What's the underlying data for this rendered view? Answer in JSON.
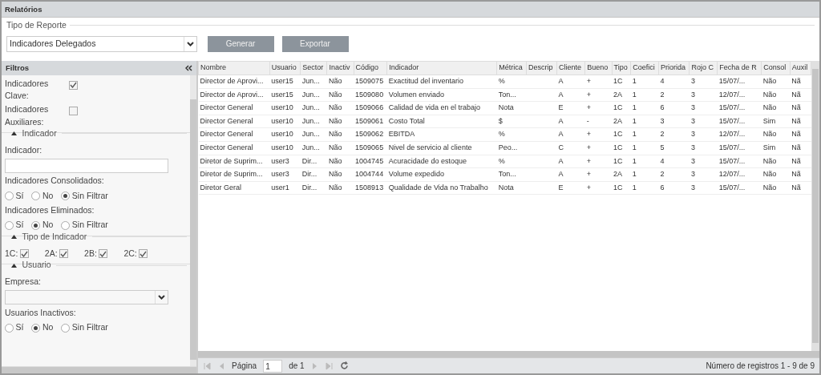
{
  "window": {
    "title": "Relatórios"
  },
  "report": {
    "legend": "Tipo de Reporte",
    "select_value": "Indicadores Delegados",
    "buttons": [
      "Generar",
      "Exportar"
    ]
  },
  "filters": {
    "title": "Filtros",
    "checks": [
      {
        "label": "Indicadores Clave:",
        "checked": true
      },
      {
        "label": "Indicadores Auxiliares:",
        "checked": false
      }
    ],
    "sections": [
      {
        "kind": "indicador",
        "legend": "Indicador",
        "expanded": true,
        "field_label": "Indicador:",
        "radio_groups": [
          {
            "label": "Indicadores Consolidados:",
            "options": [
              {
                "label": "Sí",
                "selected": false
              },
              {
                "label": "No",
                "selected": false
              },
              {
                "label": "Sin Filtrar",
                "selected": true
              }
            ]
          },
          {
            "label": "Indicadores Eliminados:",
            "options": [
              {
                "label": "Sí",
                "selected": false
              },
              {
                "label": "No",
                "selected": true
              },
              {
                "label": "Sin Filtrar",
                "selected": false
              }
            ]
          }
        ]
      },
      {
        "kind": "tipo",
        "legend": "Tipo de Indicador",
        "expanded": true,
        "types": [
          {
            "label": "1C:",
            "checked": true
          },
          {
            "label": "2A:",
            "checked": true
          },
          {
            "label": "2B:",
            "checked": true
          },
          {
            "label": "2C:",
            "checked": true
          }
        ]
      },
      {
        "kind": "usuario",
        "legend": "Usuario",
        "expanded": true,
        "field_label": "Empresa:",
        "radio_groups": [
          {
            "label": "Usuarios Inactivos:",
            "options": [
              {
                "label": "Sí",
                "selected": false
              },
              {
                "label": "No",
                "selected": true
              },
              {
                "label": "Sin Filtrar",
                "selected": false
              }
            ]
          }
        ]
      }
    ]
  },
  "table": {
    "columns": [
      "Nombre",
      "Usuario",
      "Sector",
      "Inactiv",
      "Código",
      "Indicador",
      "Métrica",
      "Descrip",
      "Cliente",
      "Bueno",
      "Tipo",
      "Coefici",
      "Priorida",
      "Rojo C",
      "Fecha de R",
      "Consol",
      "Auxil"
    ],
    "rows": [
      [
        "Director de Aprovi...",
        "user15",
        "Jun...",
        "Não",
        "1509075",
        "Exactitud del inventario",
        "%",
        "",
        "A",
        "+",
        "1C",
        "1",
        "4",
        "3",
        "15/07/...",
        "Não",
        "Nã"
      ],
      [
        "Director de Aprovi...",
        "user15",
        "Jun...",
        "Não",
        "1509080",
        "Volumen enviado",
        "Ton...",
        "",
        "A",
        "+",
        "2A",
        "1",
        "2",
        "3",
        "12/07/...",
        "Não",
        "Nã"
      ],
      [
        "Director General",
        "user10",
        "Jun...",
        "Não",
        "1509066",
        "Calidad de vida en el trabajo",
        "Nota",
        "",
        "E",
        "+",
        "1C",
        "1",
        "6",
        "3",
        "15/07/...",
        "Não",
        "Nã"
      ],
      [
        "Director General",
        "user10",
        "Jun...",
        "Não",
        "1509061",
        "Costo Total",
        "$",
        "",
        "A",
        "-",
        "2A",
        "1",
        "3",
        "3",
        "15/07/...",
        "Sim",
        "Nã"
      ],
      [
        "Director General",
        "user10",
        "Jun...",
        "Não",
        "1509062",
        "EBITDA",
        "%",
        "",
        "A",
        "+",
        "1C",
        "1",
        "2",
        "3",
        "12/07/...",
        "Não",
        "Nã"
      ],
      [
        "Director General",
        "user10",
        "Jun...",
        "Não",
        "1509065",
        "Nivel de servicio al cliente",
        "Peo...",
        "",
        "C",
        "+",
        "1C",
        "1",
        "5",
        "3",
        "15/07/...",
        "Sim",
        "Nã"
      ],
      [
        "Diretor de Suprim...",
        "user3",
        "Dir...",
        "Não",
        "1004745",
        "Acuracidade do estoque",
        "%",
        "",
        "A",
        "+",
        "1C",
        "1",
        "4",
        "3",
        "15/07/...",
        "Não",
        "Nã"
      ],
      [
        "Diretor de Suprim...",
        "user3",
        "Dir...",
        "Não",
        "1004744",
        "Volume expedido",
        "Ton...",
        "",
        "A",
        "+",
        "2A",
        "1",
        "2",
        "3",
        "12/07/...",
        "Não",
        "Nã"
      ],
      [
        "Diretor Geral",
        "user1",
        "Dir...",
        "Não",
        "1508913",
        "Qualidade de Vida no Trabalho",
        "Nota",
        "",
        "E",
        "+",
        "1C",
        "1",
        "6",
        "3",
        "15/07/...",
        "Não",
        "Nã"
      ]
    ]
  },
  "pager": {
    "page_label": "Página",
    "page_value": "1",
    "of_label": "de 1",
    "record_count": "Número de registros 1 - 9 de 9"
  }
}
